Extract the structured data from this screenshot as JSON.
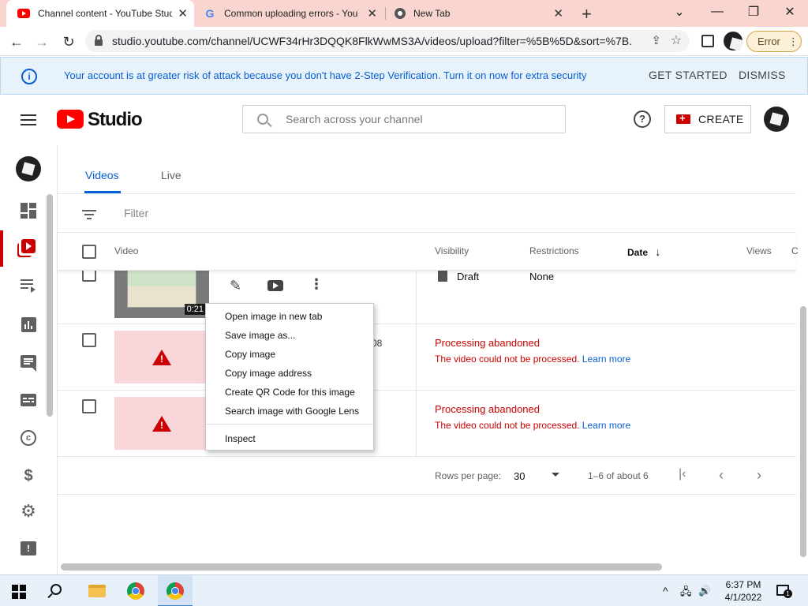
{
  "browser": {
    "tabs": [
      {
        "title": "Channel content - YouTube Studio",
        "active": true
      },
      {
        "title": "Common uploading errors - YouTube",
        "active": false
      },
      {
        "title": "New Tab",
        "active": false
      }
    ],
    "url": "studio.youtube.com/channel/UCWF34rHr3DQQK8FlkWwMS3A/videos/upload?filter=%5B%5D&sort=%7B...",
    "error_label": "Error",
    "error_menu_icon": "⋮"
  },
  "banner": {
    "message": "Your account is at greater risk of attack because you don't have 2-Step Verification. Turn it on now for extra security",
    "get_started": "GET STARTED",
    "dismiss": "DISMISS"
  },
  "header": {
    "logo_text": "Studio",
    "search_placeholder": "Search across your channel",
    "help_glyph": "?",
    "create_label": "CREATE"
  },
  "tabs": [
    {
      "label": "Videos",
      "active": true
    },
    {
      "label": "Live",
      "active": false
    }
  ],
  "filter_placeholder": "Filter",
  "table": {
    "headers": {
      "video": "Video",
      "visibility": "Visibility",
      "restrictions": "Restrictions",
      "date": "Date",
      "date_sort": "↓",
      "views": "Views",
      "comments": "C"
    },
    "rows": [
      {
        "duration": "0:21",
        "visibility": "Draft",
        "restrictions": "None"
      },
      {
        "partial_text": "08",
        "status": "Processing abandoned",
        "detail": "The video could not be processed.",
        "link": "Learn more"
      },
      {
        "status": "Processing abandoned",
        "detail": "The video could not be processed.",
        "link": "Learn more"
      }
    ]
  },
  "pager": {
    "rows_per_page_label": "Rows per page:",
    "rows_per_page": "30",
    "range": "1–6 of about 6"
  },
  "context_menu": {
    "items": [
      "Open image in new tab",
      "Save image as...",
      "Copy image",
      "Copy image address",
      "Create QR Code for this image",
      "Search image with Google Lens"
    ],
    "inspect": "Inspect"
  },
  "taskbar": {
    "time": "6:37 PM",
    "date": "4/1/2022"
  },
  "colors": {
    "accent_blue": "#065fd4",
    "brand_red": "#ff0000",
    "error_red": "#cc0000",
    "tab_strip": "#f8d6cf"
  }
}
